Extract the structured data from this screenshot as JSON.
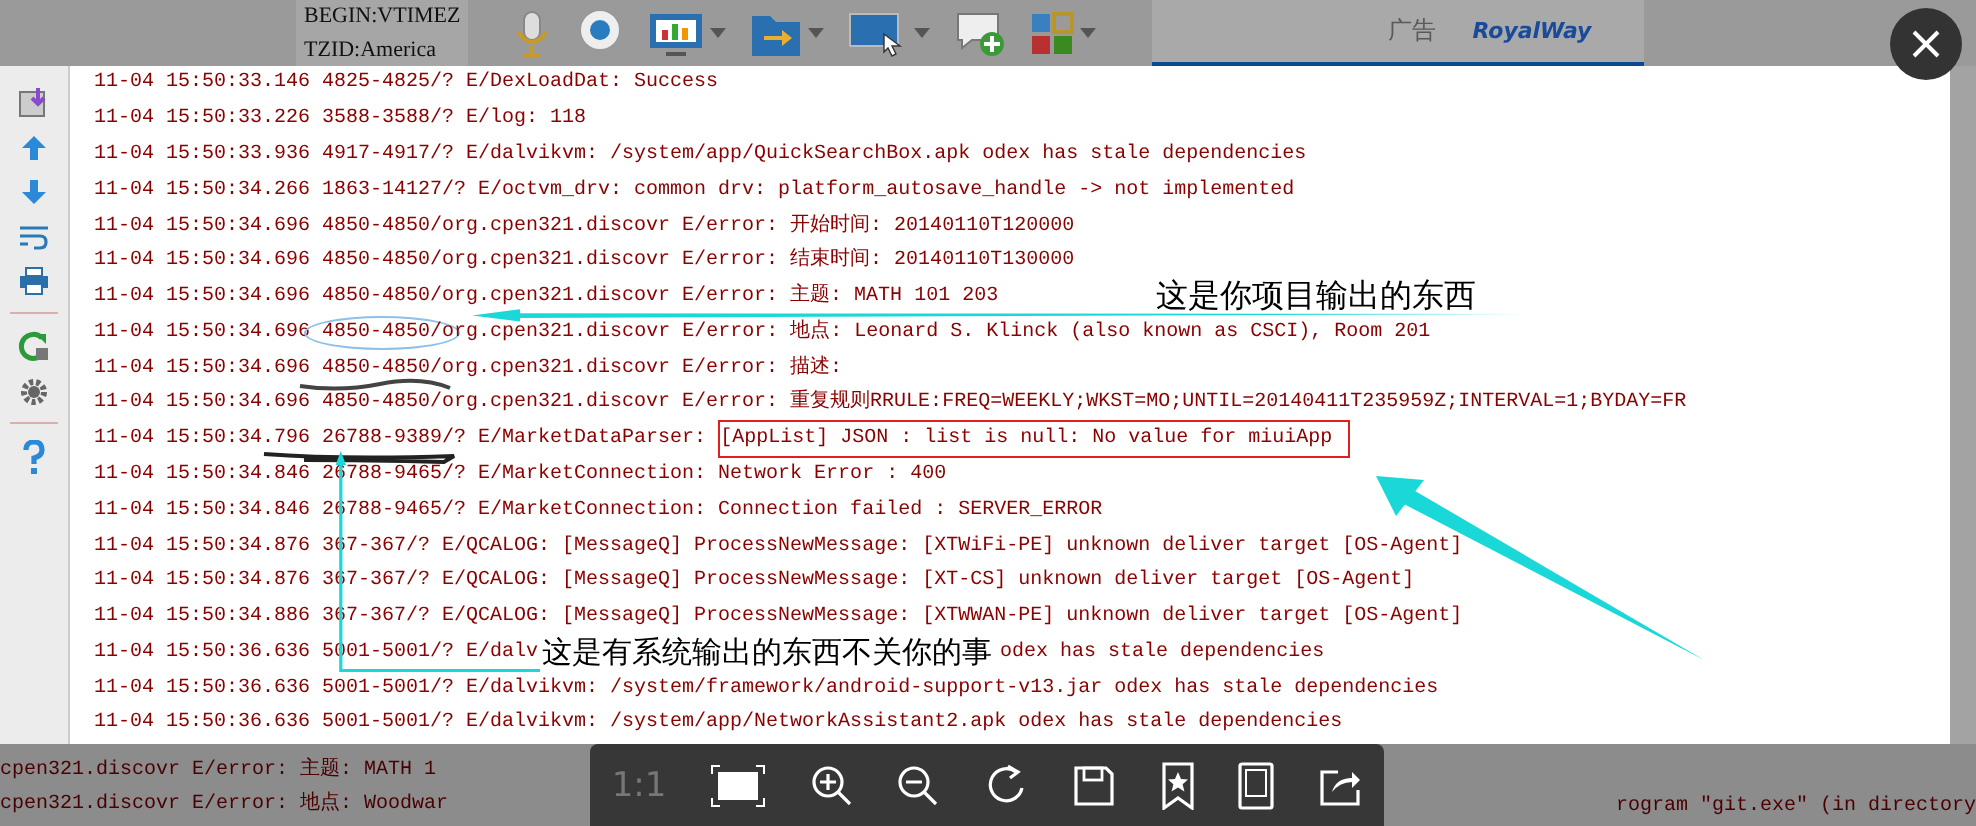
{
  "background": {
    "top_text": [
      "BEGIN:VTIMEZ",
      "TZID:America"
    ],
    "ad_label": "广告",
    "ad_logo": "RoyalWay",
    "bottom_lines": [
      "cpen321.discovr E/error: 主题: MATH 1",
      "cpen321.discovr E/error: 地点: Woodwar"
    ],
    "bottom_right_text": "rogram \"git.exe\" (in directory"
  },
  "log_lines": [
    {
      "text": "11-04 15:50:33.146 4825-4825/? E/DexLoadDat: Success"
    },
    {
      "text": "11-04 15:50:33.226 3588-3588/? E/log: 118"
    },
    {
      "text": "11-04 15:50:33.936 4917-4917/? E/dalvikvm: /system/app/QuickSearchBox.apk odex has stale dependencies"
    },
    {
      "text": "11-04 15:50:34.266 1863-14127/? E/octvm_drv: common drv: platform_autosave_handle -> not implemented"
    },
    {
      "text": "11-04 15:50:34.696 4850-4850/org.cpen321.discovr E/error: 开始时间: 20140110T120000"
    },
    {
      "text": "11-04 15:50:34.696 4850-4850/org.cpen321.discovr E/error: 结束时间: 20140110T130000"
    },
    {
      "text": "11-04 15:50:34.696 4850-4850/org.cpen321.discovr E/error: 主题: MATH 101 203"
    },
    {
      "text": "11-04 15:50:34.696 ",
      "circled": "4850-4850/",
      "tail": "org.cpen321.discovr E/error: 地点: Leonard S. Klinck (also known as CSCI), Room 201"
    },
    {
      "text": "11-04 15:50:34.696 4850-4850/org.cpen321.discovr E/error: 描述:"
    },
    {
      "text": "11-04 15:50:34.696 4850-4850/org.cpen321.discovr E/error: 重复规则RRULE:FREQ=WEEKLY;WKST=MO;UNTIL=20140411T235959Z;INTERVAL=1;BYDAY=FR"
    },
    {
      "text": "11-04 15:50:34.796 26788-9389/? E/MarketDataParser: ",
      "boxed": "[AppList] JSON : list is null: No value for miuiApp"
    },
    {
      "text": "11-04 15:50:34.846 26788-9465/? E/MarketConnection: Network Error : 400"
    },
    {
      "text": "11-04 15:50:34.846 26788-9465/? E/MarketConnection: Connection failed : SERVER_ERROR"
    },
    {
      "text": "11-04 15:50:34.876 367-367/? E/QCALOG: [MessageQ] ProcessNewMessage: [XTWiFi-PE] unknown deliver target [OS-Agent]"
    },
    {
      "text": "11-04 15:50:34.876 367-367/? E/QCALOG: [MessageQ] ProcessNewMessage: [XT-CS] unknown deliver target [OS-Agent]"
    },
    {
      "text": "11-04 15:50:34.886 367-367/? E/QCALOG: [MessageQ] ProcessNewMessage: [XTWWAN-PE] unknown deliver target [OS-Agent]"
    },
    {
      "text": "11-04 15:50:36.636 5001-5001/? E/dalv",
      "annotation": "这是有系统输出的东西不关你的事",
      "tail": "odex has stale dependencies"
    },
    {
      "text": "11-04 15:50:36.636 5001-5001/? E/dalvikvm: /system/framework/android-support-v13.jar odex has stale dependencies"
    },
    {
      "text": "11-04 15:50:36.636 5001-5001/? E/dalvikvm: /system/app/NetworkAssistant2.apk odex has stale dependencies"
    }
  ],
  "annotation": {
    "text": "这是你项目输出的东西"
  },
  "viewer_toolbar": {
    "zoom_label": "1:1"
  }
}
